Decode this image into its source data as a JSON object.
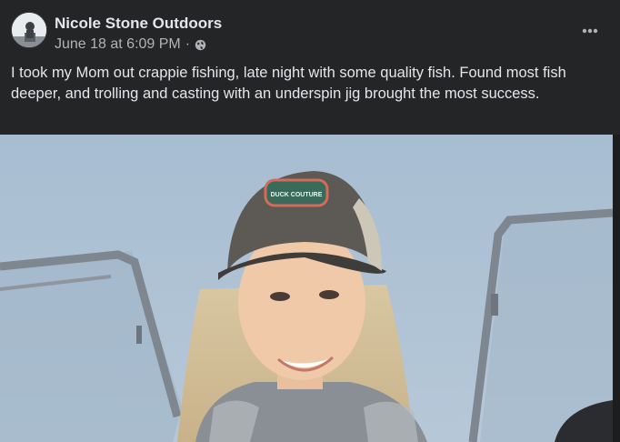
{
  "post": {
    "author": "Nicole Stone Outdoors",
    "date": "June 18 at 6:09 PM",
    "separator": "·",
    "text": "I took my Mom out crappie fishing, late night with some quality fish. Found most fish deeper, and trolling and casting with an underspin jig brought the most success.",
    "audience_icon": "globe-icon",
    "more_icon": "more-options-icon"
  },
  "photo": {
    "description_icon": "photo-image",
    "hat_patch_text": "DUCK COUTURE"
  },
  "colors": {
    "background": "#242526",
    "primary_text": "#e4e6eb",
    "secondary_text": "#b0b3b8"
  }
}
